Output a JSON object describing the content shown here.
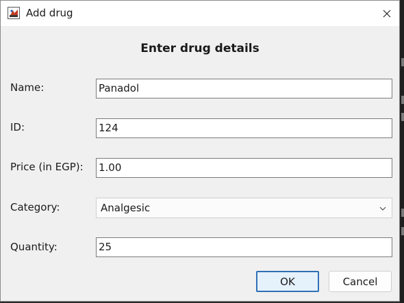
{
  "window": {
    "title": "Add drug",
    "icon": "java-app-icon",
    "close_icon": "close-icon"
  },
  "form": {
    "heading": "Enter drug details",
    "fields": {
      "name": {
        "label": "Name:",
        "value": "Panadol"
      },
      "id": {
        "label": "ID:",
        "value": "124"
      },
      "price": {
        "label": "Price (in EGP):",
        "value": "1.00"
      },
      "category": {
        "label": "Category:",
        "value": "Analgesic"
      },
      "quantity": {
        "label": "Quantity:",
        "value": "25"
      }
    }
  },
  "buttons": {
    "ok": "OK",
    "cancel": "Cancel"
  },
  "colors": {
    "dialog_bg": "#f0f0f0",
    "titlebar_bg": "#ffffff",
    "default_button_border": "#2f6fb5"
  }
}
